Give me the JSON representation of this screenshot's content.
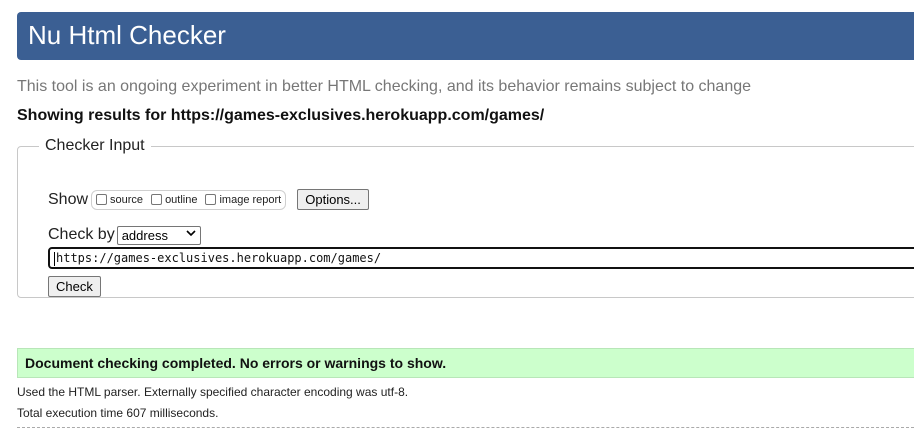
{
  "header": {
    "title": "Nu Html Checker",
    "background_color": "#3b5f93"
  },
  "intro": "This tool is an ongoing experiment in better HTML checking, and its behavior remains subject to change",
  "results_heading": "Showing results for https://games-exclusives.herokuapp.com/games/",
  "checker_input": {
    "legend": "Checker Input",
    "show_label": "Show",
    "show_options": [
      {
        "label": "source",
        "checked": false
      },
      {
        "label": "outline",
        "checked": false
      },
      {
        "label": "image report",
        "checked": false
      }
    ],
    "options_button": "Options...",
    "check_by_label": "Check by",
    "check_by_selected": "address",
    "url_value": "https://games-exclusives.herokuapp.com/games/",
    "check_button": "Check"
  },
  "result": {
    "message": "Document checking completed. No errors or warnings to show.",
    "background_color": "#ccffcc",
    "parser_info": "Used the HTML parser. Externally specified character encoding was utf-8.",
    "execution_time": "Total execution time 607 milliseconds."
  }
}
